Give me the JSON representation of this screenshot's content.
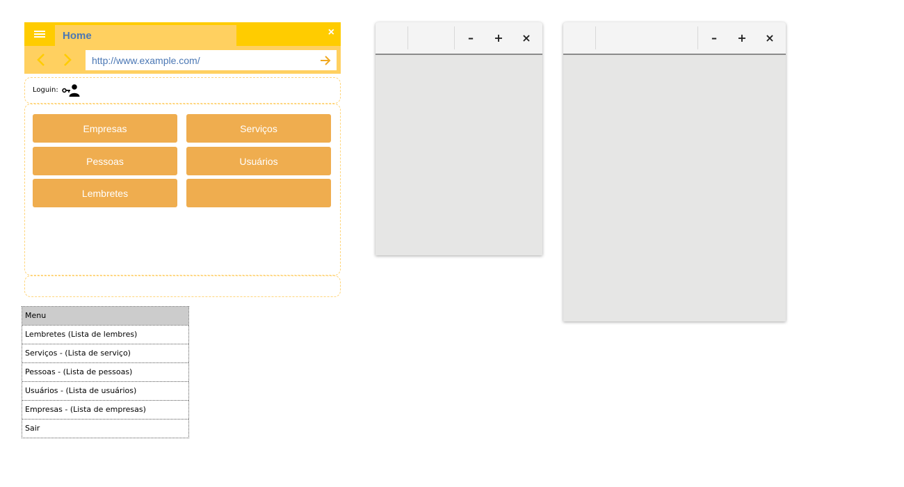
{
  "browser": {
    "tab_title": "Home",
    "tab_close": "×",
    "url": "http://www.example.com/",
    "login_label": "Loguin:",
    "buttons": [
      "Empresas",
      "Serviços",
      "Pessoas",
      "Usuários",
      "Lembretes",
      ""
    ]
  },
  "menu": {
    "header": "Menu",
    "items": [
      "Lembretes (Lista de lembres)",
      "Serviços - (Lista de serviço)",
      "Pessoas - (Lista de pessoas)",
      "Usuários - (Lista de usuários)",
      "Empresas - (Lista de empresas)",
      "Sair"
    ]
  },
  "window_controls": {
    "minimize": "–",
    "maximize": "+",
    "close": "×"
  },
  "colors": {
    "accent": "#ffcc00",
    "tab": "#ffd060",
    "button": "#efad4f",
    "link": "#4a77b4"
  }
}
